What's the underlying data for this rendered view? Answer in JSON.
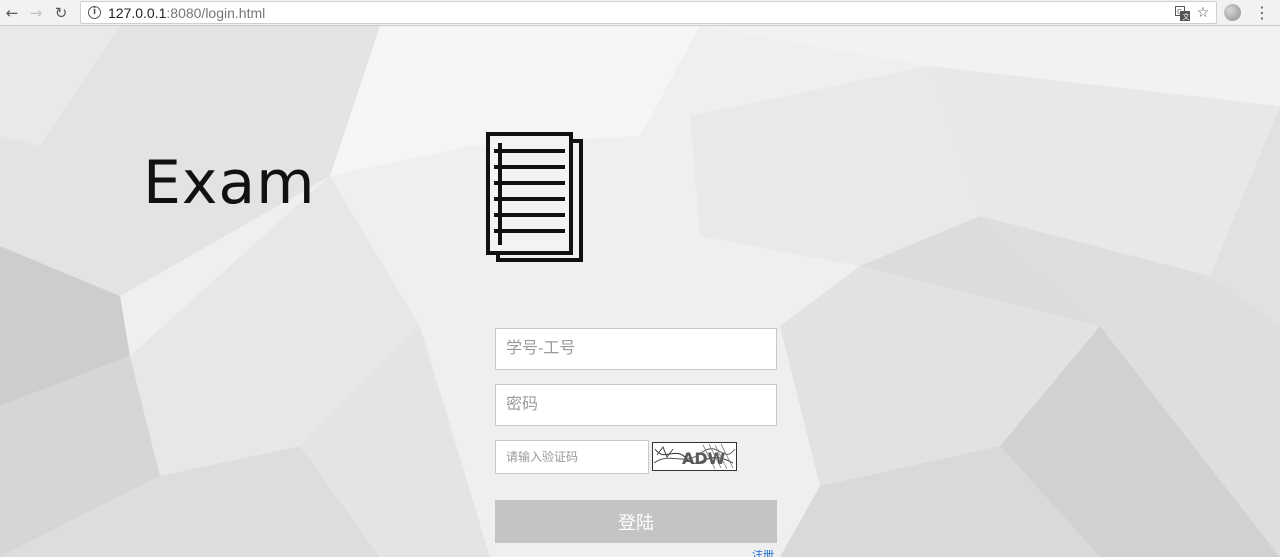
{
  "browser": {
    "url_host": "127.0.0.1",
    "url_path": ":8080/login.html"
  },
  "logo": {
    "title": "Exam"
  },
  "login_form": {
    "username_placeholder": "学号-工号",
    "password_placeholder": "密码",
    "captcha_placeholder": "请输入验证码",
    "captcha_text": "ADW",
    "submit_label": "登陆",
    "register_label": "注册"
  },
  "colors": {
    "button_disabled": "#c4c4c4",
    "link": "#1a6fd1"
  }
}
